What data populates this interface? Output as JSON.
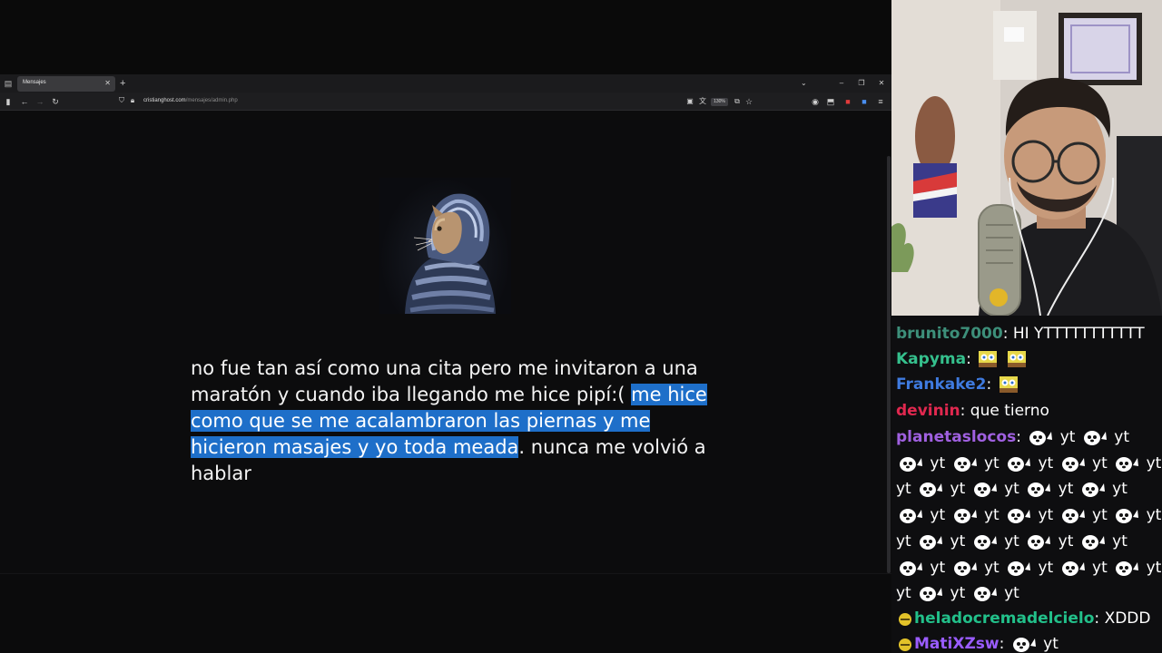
{
  "browser": {
    "tab": {
      "title": "Mensajes"
    },
    "url": {
      "domain": "cristianghost.com",
      "path": "/mensajes/admin.php"
    },
    "zoom": "130%"
  },
  "message": {
    "part1": "no fue tan así como una cita pero me invitaron a una maratón y cuando iba llegando me hice pipí:( ",
    "highlighted": "me hice como que se me acalambraron las piernas y me hicieron masajes y yo toda meada",
    "part2": ". nunca me volvió a hablar"
  },
  "chat": {
    "messages": [
      {
        "user": "brunito7000",
        "color": "#3d8f7a",
        "text": "HI YTTTTTTTTTTT"
      },
      {
        "user": "Kapyma",
        "color": "#35c08d",
        "text": "",
        "emotes": 2
      },
      {
        "user": "Frankake2",
        "color": "#3f7be0",
        "text": "",
        "emotes": 1
      },
      {
        "user": "devinin",
        "color": "#e0284f",
        "text": "que tierno"
      },
      {
        "user": "planetaslocos",
        "color": "#a060e0",
        "text": "yt",
        "repeat_word": "yt"
      },
      {
        "user": "heladocremadelcielo",
        "color": "#22c08a",
        "text": "XDDD"
      },
      {
        "user": "MatiXZsw",
        "color": "#9a5cff",
        "text": "yt"
      }
    ]
  },
  "colors": {
    "selection": "#1e6fc9",
    "page_bg": "#0c0c0d",
    "chat_bg": "#0e0e10"
  }
}
